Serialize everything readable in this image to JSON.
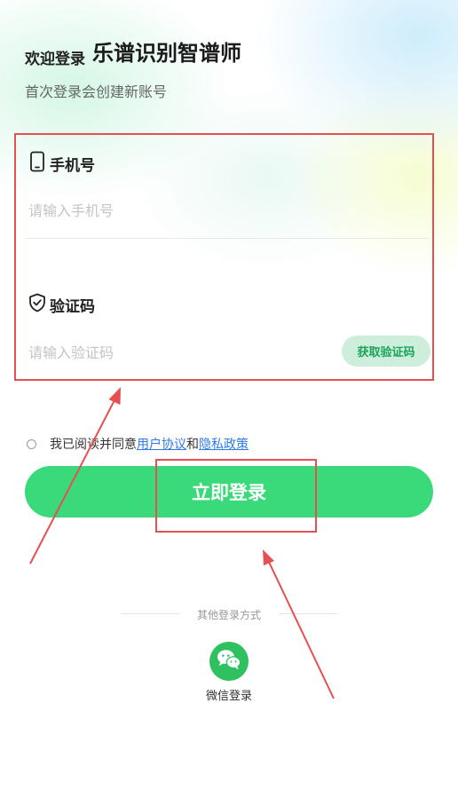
{
  "header": {
    "welcome": "欢迎登录",
    "app_name": "乐谱识别智谱师",
    "subtitle": "首次登录会创建新账号"
  },
  "form": {
    "phone_label": "手机号",
    "phone_placeholder": "请输入手机号",
    "code_label": "验证码",
    "code_placeholder": "请输入验证码",
    "get_code_label": "获取验证码"
  },
  "agreement": {
    "prefix": "我已阅读并同意",
    "user_agreement": "用户协议",
    "and": "和",
    "privacy_policy": "隐私政策"
  },
  "login_button": "立即登录",
  "other_login": {
    "title": "其他登录方式",
    "wechat_label": "微信登录"
  },
  "colors": {
    "accent": "#3ad97a",
    "code_button_bg": "#cdeedb",
    "code_button_text": "#1aa35a",
    "link": "#2f7be6",
    "annotation_red": "#e65050"
  },
  "icons": [
    "phone-icon",
    "shield-check-icon",
    "wechat-icon"
  ]
}
